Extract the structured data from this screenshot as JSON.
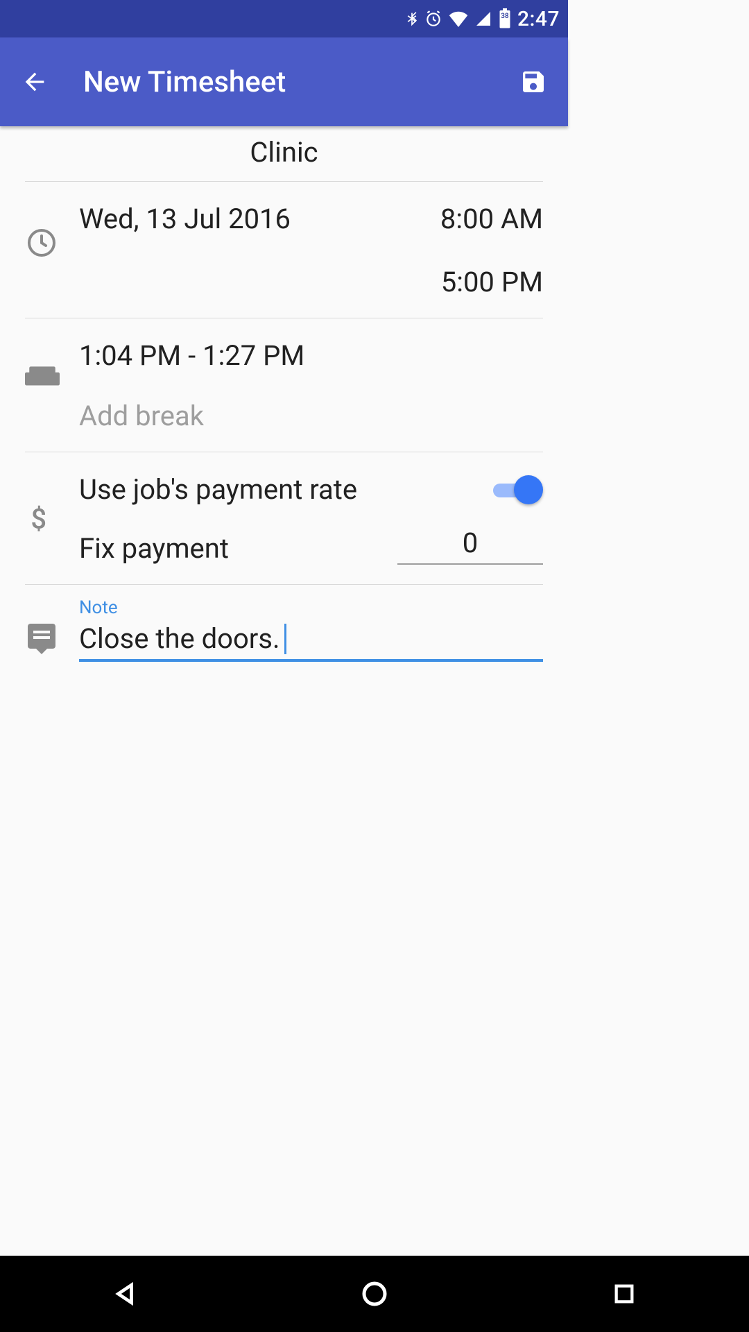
{
  "status_bar": {
    "battery_level": "38",
    "time": "2:47"
  },
  "app_bar": {
    "title": "New Timesheet"
  },
  "job_name": "Clinic",
  "date_section": {
    "date": "Wed, 13 Jul 2016",
    "start_time": "8:00 AM",
    "end_time": "5:00 PM"
  },
  "break_section": {
    "break1": "1:04 PM - 1:27 PM",
    "add_break_label": "Add break"
  },
  "payment_section": {
    "use_rate_label": "Use job's payment rate",
    "use_rate_on": true,
    "fix_label": "Fix payment",
    "fix_value": "0"
  },
  "note_section": {
    "label": "Note",
    "value": "Close the doors."
  }
}
